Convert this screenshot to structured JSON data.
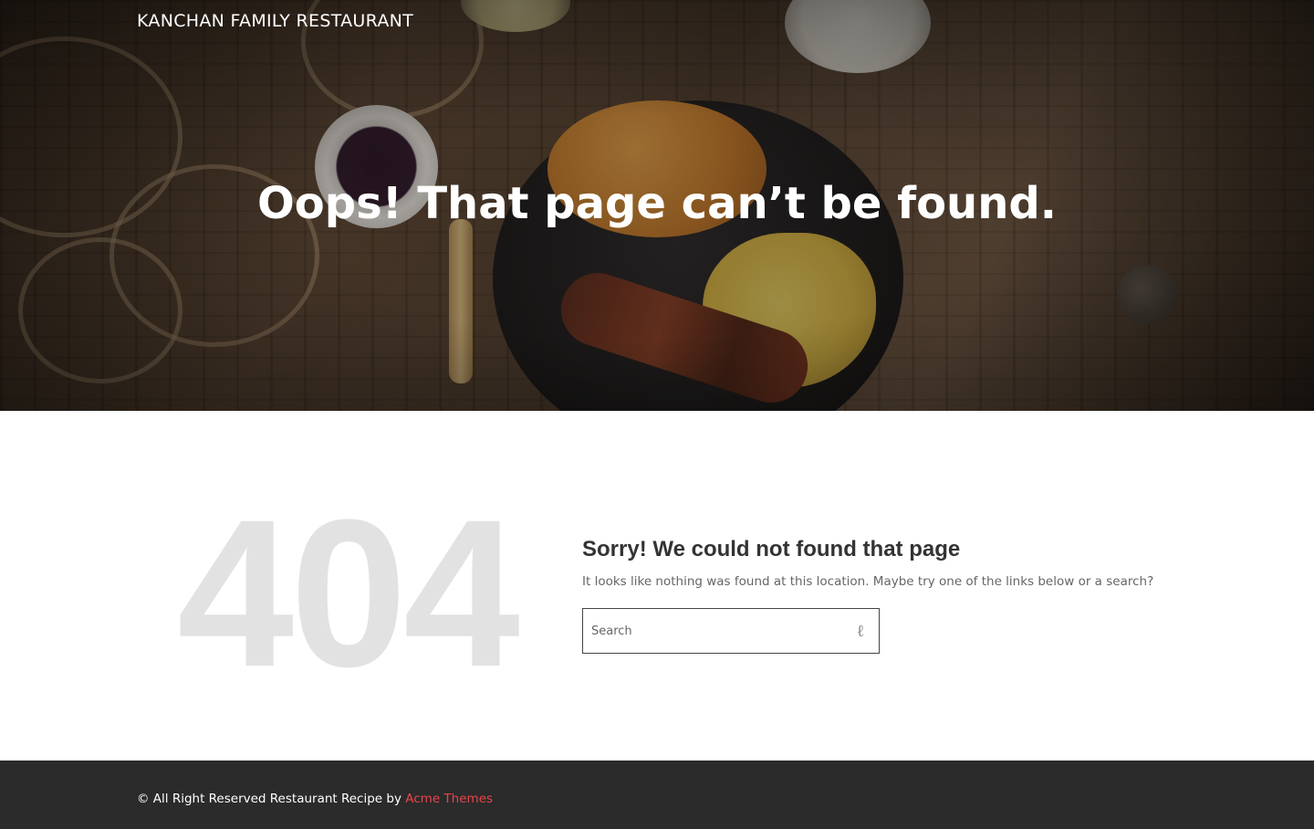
{
  "header": {
    "site_title": "KANCHAN FAMILY RESTAURANT"
  },
  "hero": {
    "heading": "Oops! That page can’t be found."
  },
  "error": {
    "code": "404",
    "title": "Sorry! We could not found that page",
    "message": "It looks like nothing was found at this location. Maybe try one of the links below or a search?"
  },
  "search": {
    "placeholder": "Search",
    "value": "",
    "button_icon": "search-icon"
  },
  "footer": {
    "copyright": "© All Right Reserved Restaurant Recipe by",
    "link_text": "Acme Themes",
    "link_color": "#e8454a",
    "background": "#2b2b2b"
  }
}
